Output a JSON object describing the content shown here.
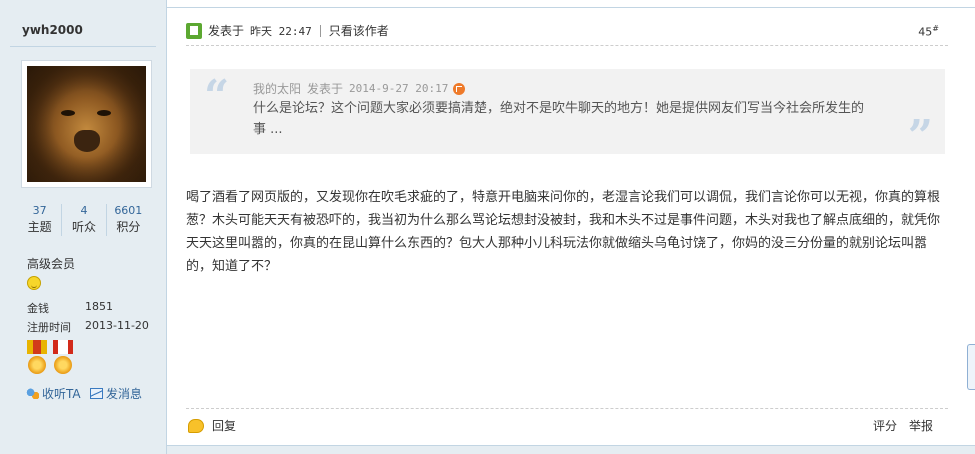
{
  "author": {
    "username": "ywh2000",
    "stats": [
      {
        "value": "37",
        "label": "主题"
      },
      {
        "value": "4",
        "label": "听众"
      },
      {
        "value": "6601",
        "label": "积分"
      }
    ],
    "group": "高级会员",
    "money_label": "金钱",
    "money_value": "1851",
    "register_label": "注册时间",
    "register_value": "2013-11-20",
    "follow_label": "收听TA",
    "message_label": "发消息"
  },
  "post": {
    "posted_label": "发表于",
    "posted_time": "昨天 22:47",
    "only_author_label": "只看该作者",
    "floor_number": "45",
    "floor_suffix": "#",
    "quote": {
      "author": "我的太阳",
      "posted_label": "发表于",
      "time": "2014-9-27 20:17",
      "text": "什么是论坛？这个问题大家必须要搞清楚，绝对不是吹牛聊天的地方！她是提供网友们写当今社会所发生的事 ..."
    },
    "content": "喝了酒看了网页版的，又发现你在吹毛求疵的了，特意开电脑来问你的，老湿言论我们可以调侃，我们言论你可以无视，你真的算根葱？木头可能天天有被恐吓的，我当初为什么那么骂论坛想封没被封，我和木头不过是事件问题，木头对我也了解点底细的，就凭你天天这里叫嚣的，你真的在昆山算什么东西的？包大人那种小儿科玩法你就做缩头乌龟讨饶了，你妈的没三分份量的就别论坛叫嚣的，知道了不？",
    "reply_label": "回复",
    "rate_label": "评分",
    "report_label": "举报"
  }
}
